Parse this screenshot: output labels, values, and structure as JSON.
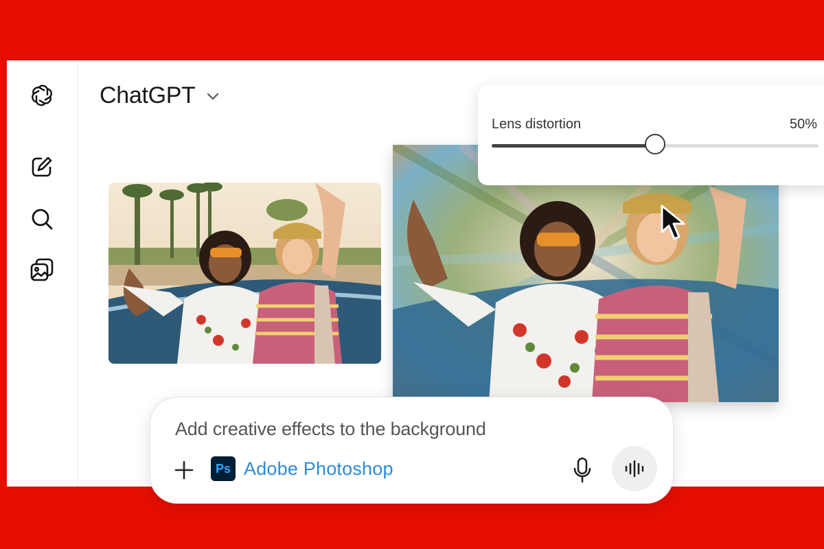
{
  "app": {
    "title": "ChatGPT"
  },
  "sidebar": {
    "items": [
      {
        "icon": "openai-logo-icon"
      },
      {
        "icon": "new-chat-icon"
      },
      {
        "icon": "search-icon"
      },
      {
        "icon": "images-icon"
      }
    ]
  },
  "slider": {
    "label": "Lens distortion",
    "value_text": "50%",
    "value": 0.5
  },
  "composer": {
    "prompt": "Add creative effects to the background",
    "plus_icon": "plus-icon",
    "app_badge": "Ps",
    "app_name": "Adobe Photoshop",
    "mic_icon": "microphone-icon",
    "voice_icon": "voice-mode-icon"
  },
  "colors": {
    "background": "#e60e00",
    "window": "#ffffff",
    "accent_blue": "#2b8bd7",
    "ps_dark": "#001e36",
    "ps_light": "#31a8ff"
  }
}
